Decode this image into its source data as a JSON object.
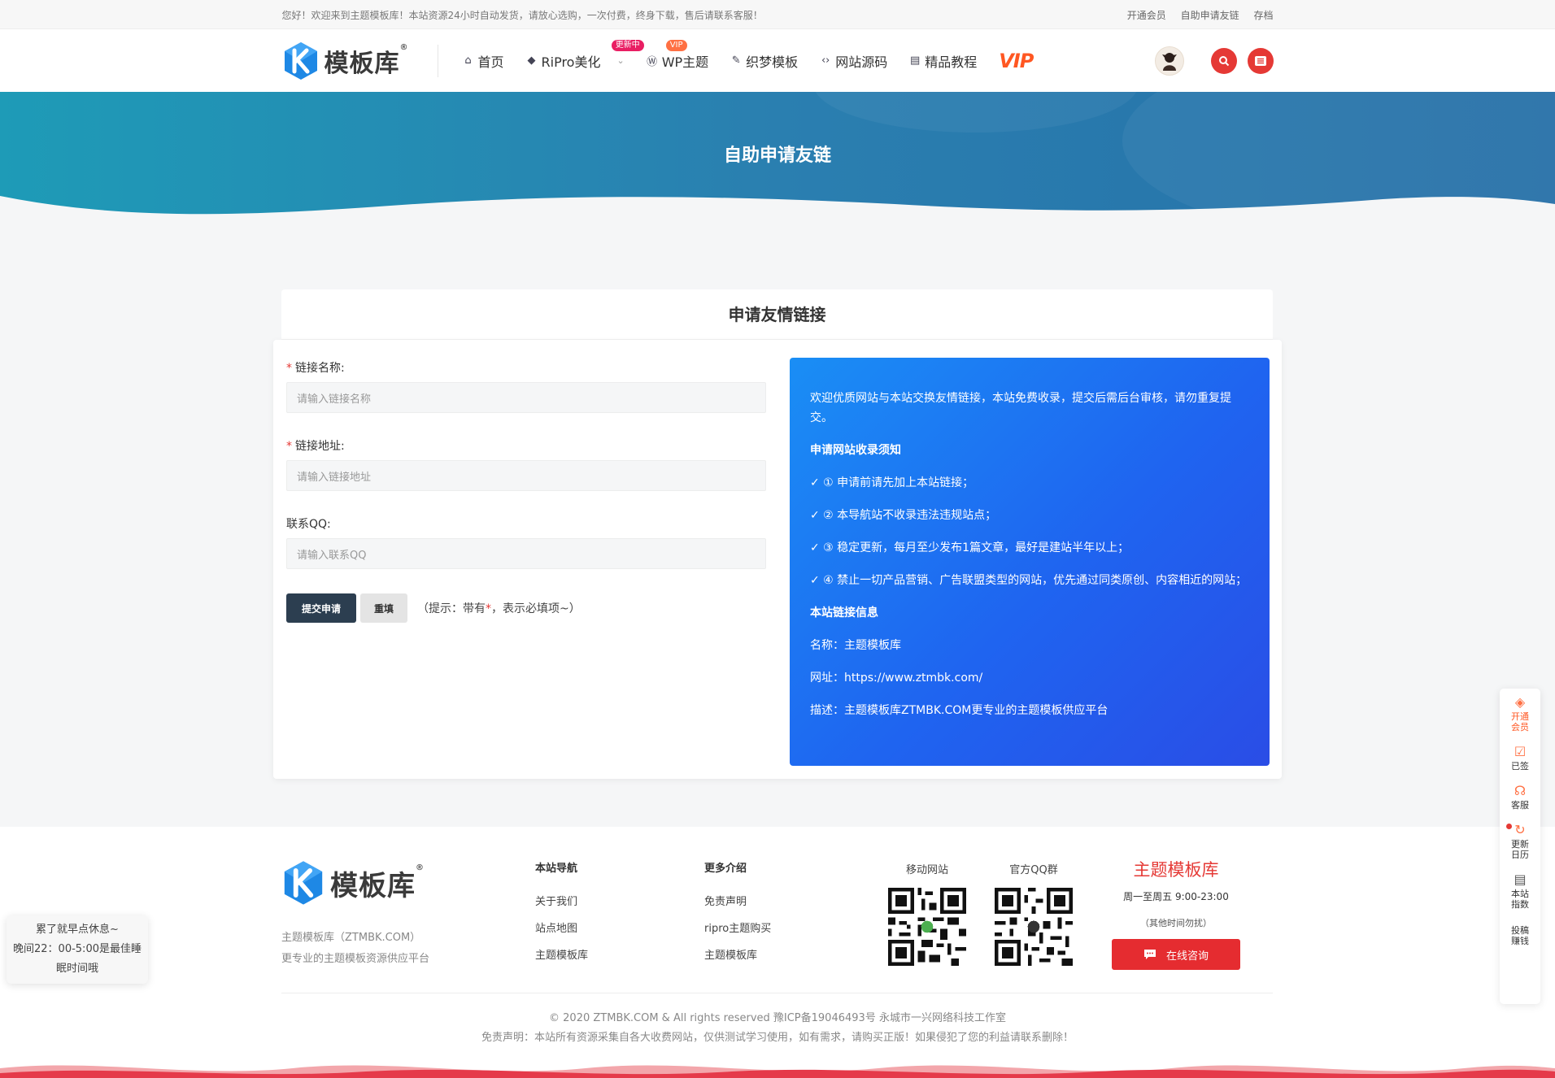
{
  "topbar": {
    "welcome": "您好！欢迎来到主题模板库！本站资源24小时自动发货，请放心选购，一次付费，终身下载，售后请联系客服！",
    "links": [
      "开通会员",
      "自助申请友链",
      "存档"
    ]
  },
  "header": {
    "logo_text": "模板库",
    "logo_reg": "®",
    "nav": [
      {
        "label": "首页",
        "icon": "home-icon"
      },
      {
        "label": "RiPro美化",
        "icon": "diamond-icon",
        "badge": "更新中"
      },
      {
        "label": "WP主题",
        "icon": "wordpress-icon",
        "badge": "VIP"
      },
      {
        "label": "织梦模板",
        "icon": "leaf-icon"
      },
      {
        "label": "网站源码",
        "icon": "code-icon"
      },
      {
        "label": "精品教程",
        "icon": "document-icon"
      }
    ],
    "vip_label": "VIP"
  },
  "hero": {
    "title": "自助申请友链"
  },
  "form": {
    "title": "申请友情链接",
    "fields": [
      {
        "label": "链接名称:",
        "required": true,
        "placeholder": "请输入链接名称"
      },
      {
        "label": "链接地址:",
        "required": true,
        "placeholder": "请输入链接地址"
      },
      {
        "label": "联系QQ:",
        "required": false,
        "placeholder": "请输入联系QQ"
      }
    ],
    "submit_label": "提交申请",
    "reset_label": "重填",
    "hint_prefix": "（提示：带有",
    "hint_star": "*",
    "hint_suffix": "，表示必填项~）"
  },
  "info": {
    "intro": "欢迎优质网站与本站交换友情链接，本站免费收录，提交后需后台审核，请勿重复提交。",
    "rules_title": "申请网站收录须知",
    "rules": [
      "✓ ① 申请前请先加上本站链接；",
      "✓ ② 本导航站不收录违法违规站点；",
      "✓ ③ 稳定更新，每月至少发布1篇文章，最好是建站半年以上；",
      "✓ ④ 禁止一切产品营销、广告联盟类型的网站，优先通过同类原创、内容相近的网站；"
    ],
    "site_title": "本站链接信息",
    "site_name": "名称：主题模板库",
    "site_url": "网址：https://www.ztmbk.com/",
    "site_desc": "描述：主题模板库ZTMBK.COM更专业的主题模板供应平台"
  },
  "footer": {
    "logo_text": "模板库",
    "logo_reg": "®",
    "desc_line1": "主题模板库（ZTMBK.COM）",
    "desc_line2": "更专业的主题模板资源供应平台",
    "col1_title": "本站导航",
    "col1_links": [
      "关于我们",
      "站点地图",
      "主题模板库"
    ],
    "col2_title": "更多介绍",
    "col2_links": [
      "免责声明",
      "ripro主题购买",
      "主题模板库"
    ],
    "qr1_label": "移动网站",
    "qr2_label": "官方QQ群",
    "contact_brand": "主题模板库",
    "contact_hours": "周一至周五 9:00-23:00",
    "contact_other": "（其他时间勿扰）",
    "chat_label": "在线咨询",
    "copyright": "© 2020 ZTMBK.COM & All rights reserved   豫ICP备19046493号   永城市一兴网络科技工作室",
    "disclaimer": "免责声明：本站所有资源采集自各大收费网站，仅供测试学习使用，如有需求，请购买正版！如果侵犯了您的利益请联系删除！"
  },
  "rest_tip": {
    "line1": "累了就早点休息~",
    "line2": "晚间22：00-5:00是最佳睡",
    "line3": "眠时间哦"
  },
  "sidebar": [
    {
      "label": "开通会员",
      "icon": "vip-diamond-icon"
    },
    {
      "label": "已签",
      "icon": "calendar-check-icon"
    },
    {
      "label": "客服",
      "icon": "headset-icon"
    },
    {
      "label": "更新日历",
      "icon": "refresh-icon"
    },
    {
      "label": "本站指数",
      "icon": "clipboard-icon"
    },
    {
      "label": "投稿赚钱",
      "icon": "edit-icon"
    }
  ],
  "colors": {
    "brand_red": "#e53935",
    "hero_blue": "#2a7fb0",
    "info_gradient_start": "#1a8ef5",
    "info_gradient_end": "#2a4de6",
    "submit_btn": "#2c3e50"
  }
}
